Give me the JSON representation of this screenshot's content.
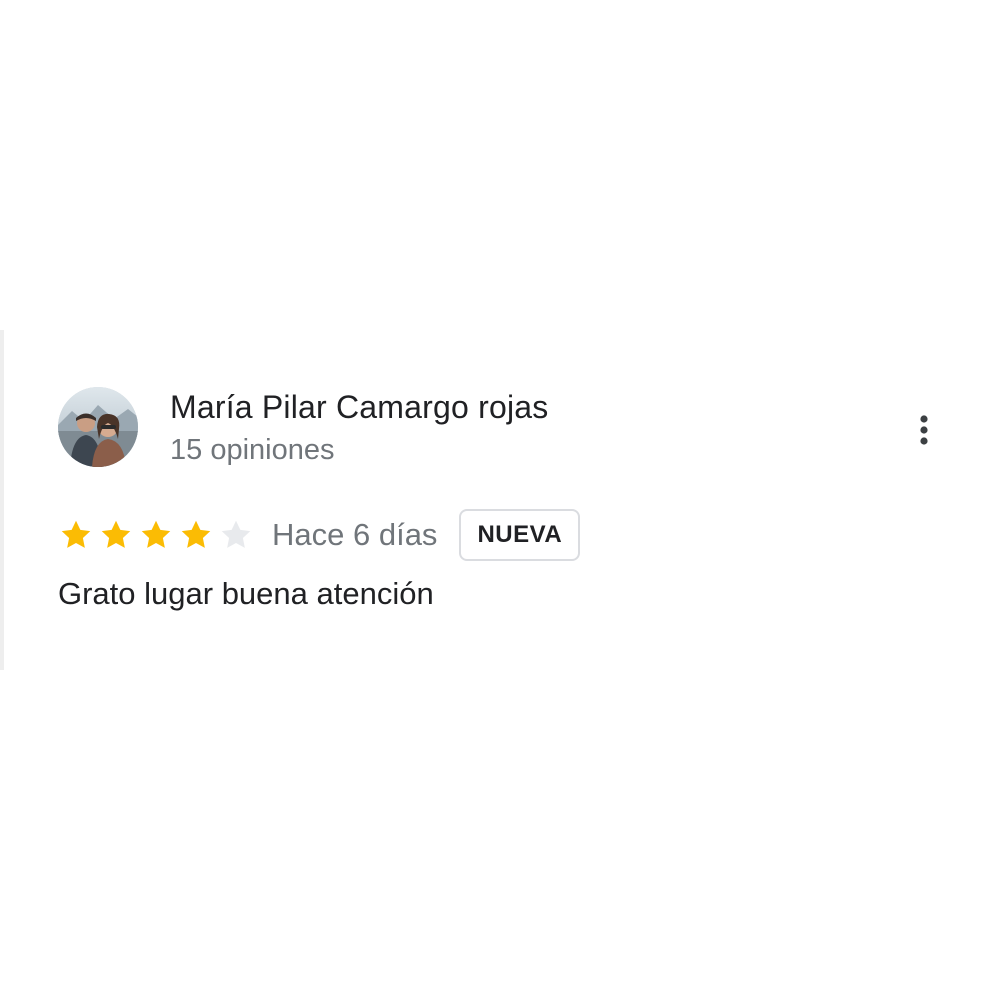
{
  "review": {
    "reviewer_name": "María Pilar Camargo rojas",
    "review_count": "15 opiniones",
    "rating": 4,
    "rating_max": 5,
    "date": "Hace 6 días",
    "badge": "NUEVA",
    "text": "Grato lugar buena atención"
  },
  "icons": {
    "avatar": "avatar-photo",
    "more": "more-vert-icon",
    "star": "star-icon"
  },
  "colors": {
    "star_filled": "#fbbc04",
    "star_empty": "#e8eaed",
    "text_primary": "#202124",
    "text_secondary": "#70757a",
    "badge_border": "#dadce0"
  }
}
